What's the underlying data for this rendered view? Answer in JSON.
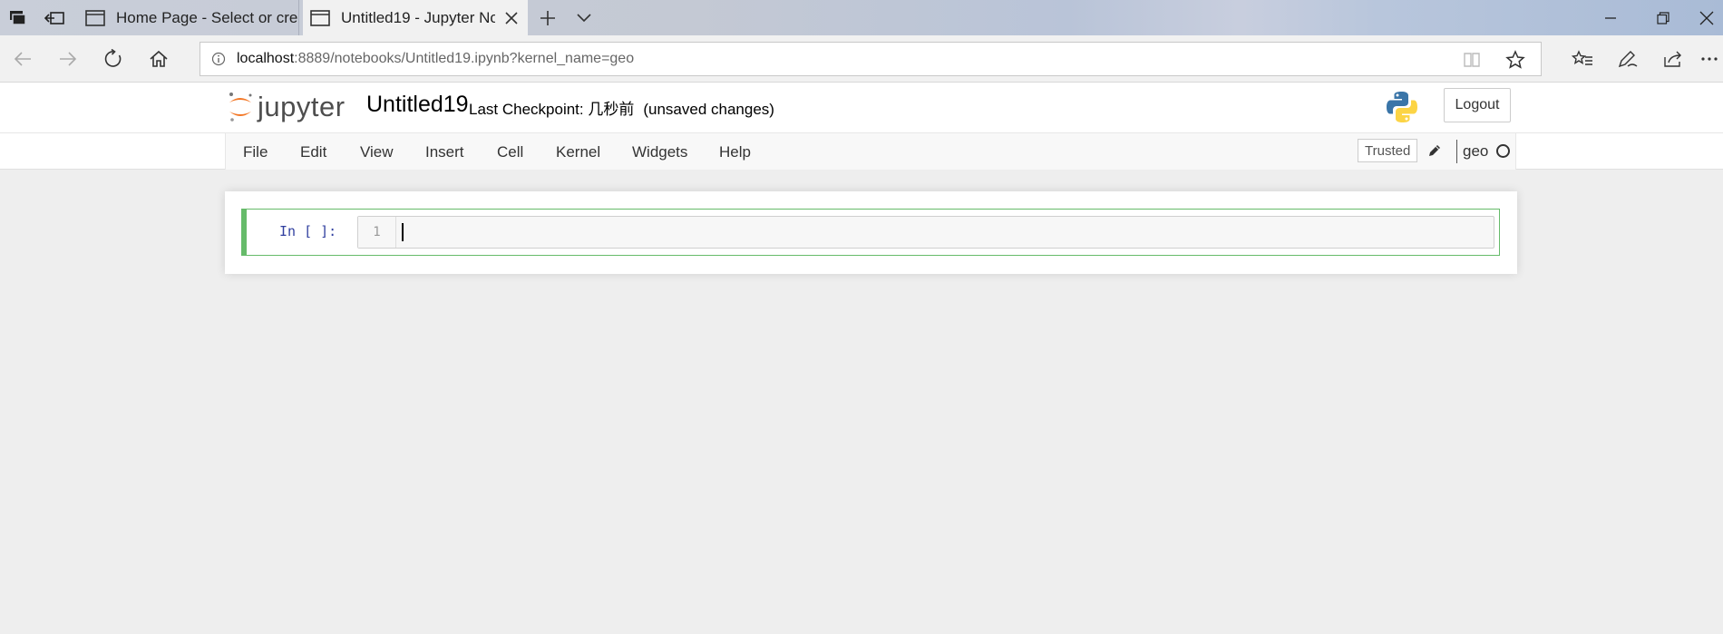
{
  "browser": {
    "tabs": [
      {
        "title": "Home Page - Select or creat",
        "active": false
      },
      {
        "title": "Untitled19 - Jupyter No",
        "active": true
      }
    ],
    "url_host": "localhost",
    "url_rest": ":8889/notebooks/Untitled19.ipynb?kernel_name=geo"
  },
  "jupyter": {
    "logo_text": "jupyter",
    "notebook_name": "Untitled19",
    "checkpoint": "Last Checkpoint: 几秒前",
    "unsaved": "(unsaved changes)",
    "logout_label": "Logout",
    "menu": [
      "File",
      "Edit",
      "View",
      "Insert",
      "Cell",
      "Kernel",
      "Widgets",
      "Help"
    ],
    "trusted_label": "Trusted",
    "kernel_name": "geo",
    "cell": {
      "prompt": "In [ ]:",
      "line_number": "1",
      "code": ""
    }
  },
  "colors": {
    "cell_border": "#66bb6a",
    "prompt_color": "#303f9f",
    "logo_orange": "#f37726"
  }
}
